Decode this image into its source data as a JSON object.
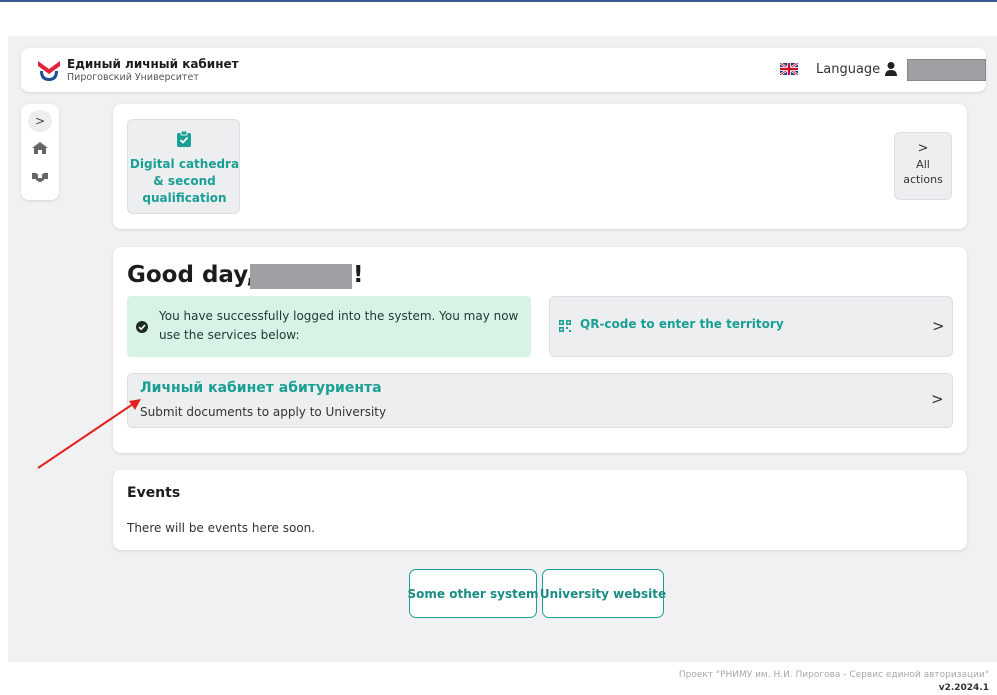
{
  "header": {
    "logo_title": "Единый личный кабинет",
    "logo_subtitle": "Пироговский Университет",
    "language_label": "Language",
    "language_flag": "uk-flag-icon",
    "user_icon": "user-icon"
  },
  "sidebar": {
    "toggle_label": ">",
    "items": [
      {
        "icon": "home-icon"
      },
      {
        "icon": "handshake-icon"
      }
    ]
  },
  "quick_actions": {
    "tile_label": "Digital cathedra & second qualification",
    "tile_icon": "clipboard-check-icon",
    "all_actions_chevron": ">",
    "all_actions_label": "All actions"
  },
  "greeting": {
    "prefix": "Good day,",
    "suffix": "!",
    "login_message": "You have successfully logged into the system. You may now use the services below:",
    "qr_label": "QR-code to enter the territory",
    "applicant_title": "Личный кабинет абитуриента",
    "applicant_subtitle": "Submit documents to apply to University",
    "chevron": ">"
  },
  "events": {
    "title": "Events",
    "empty_message": "There will be events here soon."
  },
  "external_links": [
    {
      "label": "Some other system"
    },
    {
      "label": "University website"
    }
  ],
  "footer": {
    "project_text": "Проект \"РНИМУ им. Н.И. Пирогова - Сервис единой авторизации\"",
    "version": "v2.2024.1"
  },
  "colors": {
    "accent": "#1a9f94",
    "success_bg": "#d9f2e6",
    "annotation_arrow": "#e0231c",
    "logo_red": "#e4223b",
    "logo_blue": "#1d4f91"
  }
}
